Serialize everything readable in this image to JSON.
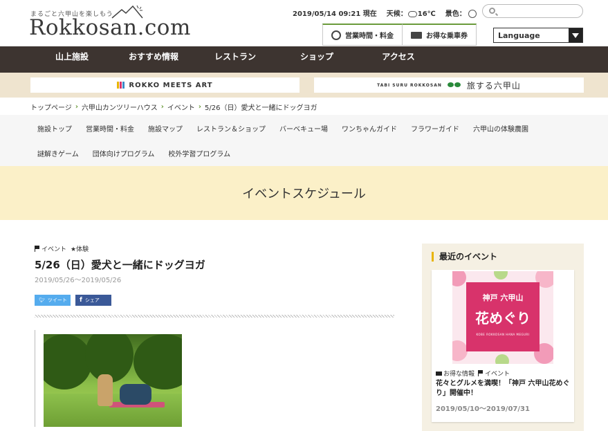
{
  "header": {
    "tagline": "まるごと六甲山を楽しもう",
    "logo": "Rokkosan.com",
    "datetime": "2019/05/14 09:21 現在",
    "weather_label": "天候：",
    "temperature": "16℃",
    "view_label": "景色：",
    "search_placeholder": "",
    "hours_button": "営業時間・料金",
    "ticket_button": "お得な乗車券",
    "language": "Language"
  },
  "nav": {
    "items": [
      "山上施設",
      "おすすめ情報",
      "レストラン",
      "ショップ",
      "アクセス"
    ]
  },
  "banners": {
    "art": "ROKKO MEETS ART",
    "tabi_small": "TABI SURU ROKKOSAN",
    "tabi_big": "旅する六甲山"
  },
  "breadcrumb": [
    "トップページ",
    "六甲山カンツリーハウス",
    "イベント",
    "5/26（日）愛犬と一緒にドッグヨガ"
  ],
  "subnav": {
    "row1": [
      "施設トップ",
      "営業時間・料金",
      "施設マップ",
      "レストラン＆ショップ",
      "バーベキュー場",
      "ワンちゃんガイド",
      "フラワーガイド",
      "六甲山の体験農園"
    ],
    "row2": [
      "謎解きゲーム",
      "団体向けプログラム",
      "校外学習プログラム"
    ]
  },
  "page_title": "イベントスケジュール",
  "article": {
    "tag1": "イベント",
    "tag2": "体験",
    "title": "5/26（日）愛犬と一緒にドッグヨガ",
    "date": "2019/05/26〜2019/05/26",
    "tweet": "ツイート",
    "share": "シェア"
  },
  "sidebar": {
    "heading": "最近のイベント",
    "card": {
      "img_line1": "神戸 六甲山",
      "img_line2": "花めぐり",
      "img_line3": "KOBE ROKKOSAN HANA MEGURI",
      "tag1": "お得な情報",
      "tag2": "イベント",
      "title": "花々とグルメを満喫！「神戸 六甲山花めぐり」開催中！",
      "date": "2019/05/10〜2019/07/31"
    }
  },
  "colors": {
    "nav_bg": "#3d3430",
    "accent_green": "#6a9a3a",
    "title_band": "#fbf0c8",
    "sidebar_bg": "#f5f0e3",
    "pink": "#d8336b"
  }
}
